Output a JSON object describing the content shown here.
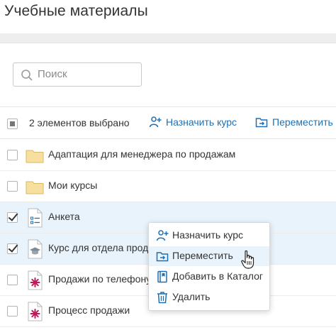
{
  "page": {
    "title": "Учебные материалы"
  },
  "search": {
    "placeholder": "Поиск"
  },
  "bulk": {
    "selected_text": "2 элементов выбрано",
    "assign_label": "Назначить курс",
    "move_label": "Переместить"
  },
  "rows": [
    {
      "label": "Адаптация для менеджера по продажам",
      "icon": "folder-icon",
      "checked": false,
      "selected": false
    },
    {
      "label": "Мои курсы",
      "icon": "folder-icon",
      "checked": false,
      "selected": false
    },
    {
      "label": "Анкета",
      "icon": "form-document-icon",
      "checked": true,
      "selected": true
    },
    {
      "label": "Курс для отдела продаж",
      "icon": "course-graduation-cap-icon",
      "checked": true,
      "selected": true
    },
    {
      "label": "Продажи по телефону",
      "icon": "presentation-file-icon",
      "checked": false,
      "selected": false
    },
    {
      "label": "Процесс продажи",
      "icon": "presentation-file-icon",
      "checked": false,
      "selected": false
    }
  ],
  "context_menu": {
    "items": [
      {
        "label": "Назначить курс",
        "icon": "assign-user-icon"
      },
      {
        "label": "Переместить",
        "icon": "move-folder-icon",
        "hovered": true
      },
      {
        "label": "Добавить в Каталог",
        "icon": "catalog-book-icon"
      },
      {
        "label": "Удалить",
        "icon": "trash-icon"
      }
    ]
  },
  "colors": {
    "accent": "#1f6fb2",
    "selected_row": "#e9f3fb",
    "folder": "#f7dfa0",
    "presentation_icon": "#c2185b"
  }
}
